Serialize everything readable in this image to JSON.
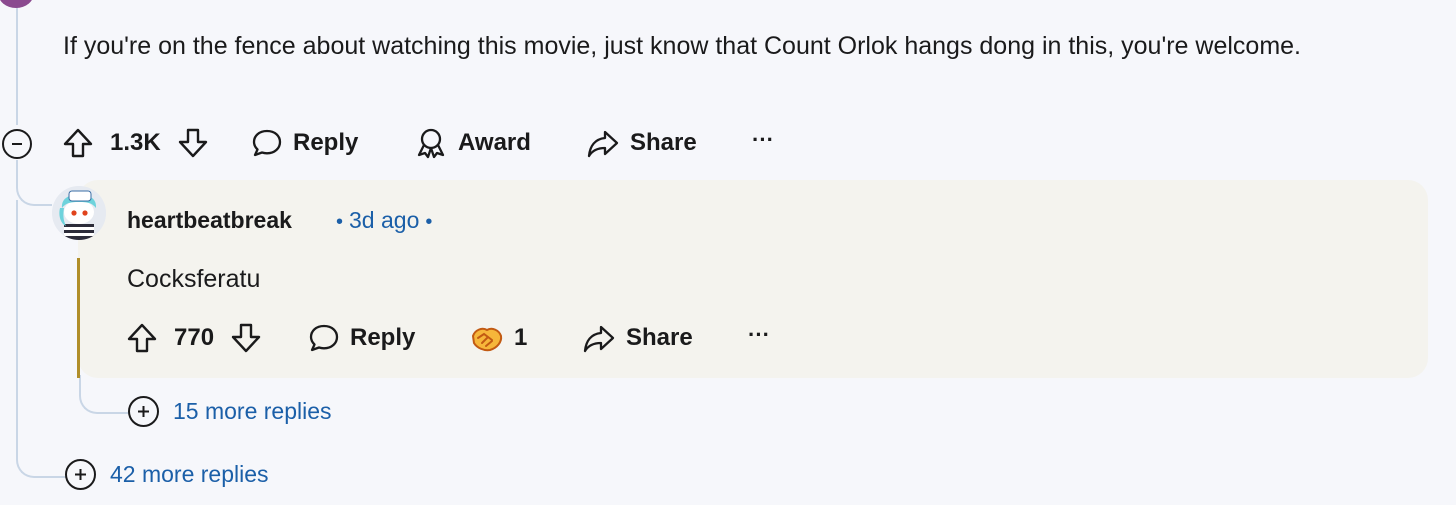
{
  "parent_comment": {
    "body": "If you're on the fence about watching this movie, just know that Count Orlok hangs dong in this, you're welcome.",
    "votes": "1.3K",
    "reply_label": "Reply",
    "award_label": "Award",
    "share_label": "Share",
    "more_label": "···"
  },
  "reply_comment": {
    "author": "heartbeatbreak",
    "timestamp": "3d ago",
    "body": "Cocksferatu",
    "votes": "770",
    "reply_label": "Reply",
    "award_count": "1",
    "share_label": "Share",
    "more_label": "···"
  },
  "nested_more": {
    "label": "15 more replies"
  },
  "thread_more": {
    "label": "42 more replies"
  },
  "colors": {
    "link": "#1b5fa8",
    "thread_line": "#c9d6e6",
    "reply_bg": "#f4f3ee",
    "highlight_line": "#b08e2a"
  }
}
